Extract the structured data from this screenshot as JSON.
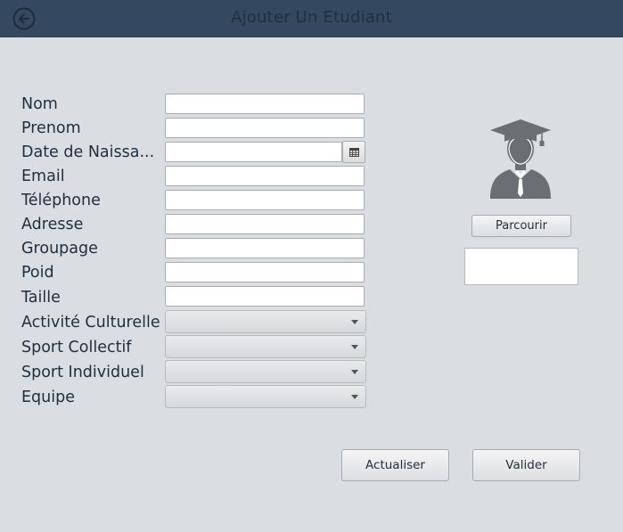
{
  "header": {
    "title": "Ajouter Un  Etudiant",
    "back_icon": "back-arrow-icon"
  },
  "form": {
    "fields": [
      {
        "label": "Nom",
        "value": ""
      },
      {
        "label": "Prenom",
        "value": ""
      },
      {
        "label": "Date de Naissa...",
        "value": ""
      },
      {
        "label": "Email",
        "value": ""
      },
      {
        "label": "Téléphone",
        "value": ""
      },
      {
        "label": "Adresse",
        "value": ""
      },
      {
        "label": "Groupage",
        "value": ""
      },
      {
        "label": "Poid",
        "value": ""
      },
      {
        "label": "Taille",
        "value": ""
      }
    ],
    "selects": [
      {
        "label": "Activité Culturelle",
        "value": ""
      },
      {
        "label": "Sport Collectif",
        "value": ""
      },
      {
        "label": "Sport Individuel",
        "value": ""
      },
      {
        "label": "Equipe",
        "value": ""
      }
    ]
  },
  "photo": {
    "avatar_icon": "student-graduate-icon",
    "browse_label": "Parcourir",
    "path_value": ""
  },
  "actions": {
    "refresh_label": "Actualiser",
    "validate_label": "Valider"
  },
  "colors": {
    "header_bg": "#34495f",
    "page_bg": "#dadde2",
    "avatar": "#6b6f73"
  }
}
